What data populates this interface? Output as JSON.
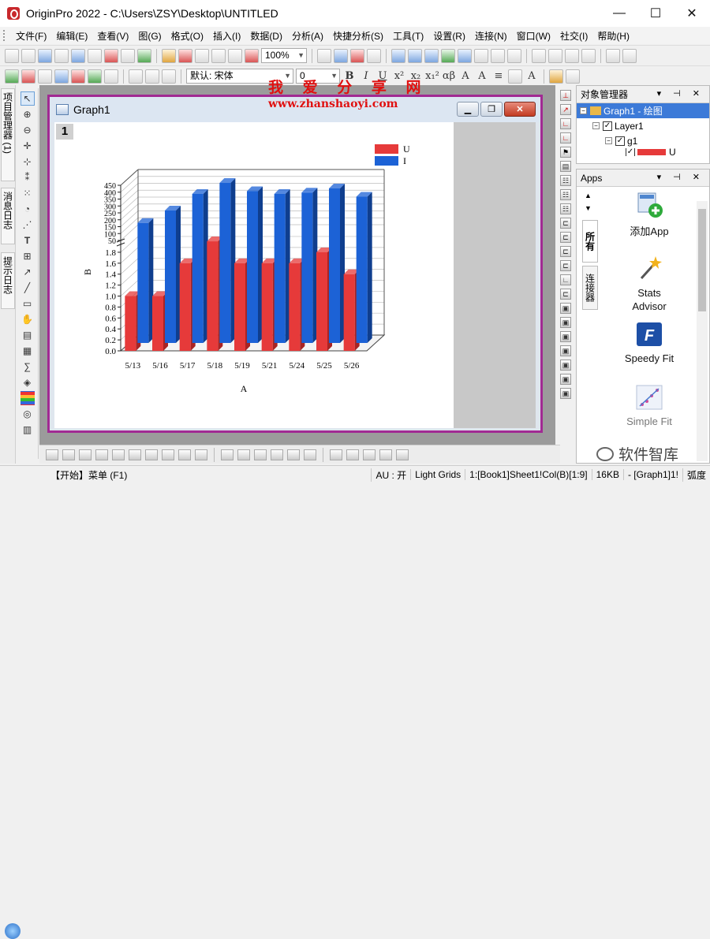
{
  "window": {
    "title": "OriginPro 2022 - C:\\Users\\ZSY\\Desktop\\UNTITLED",
    "controls": [
      "—",
      "☐",
      "✕"
    ]
  },
  "menu": [
    "文件(F)",
    "编辑(E)",
    "查看(V)",
    "图(G)",
    "格式(O)",
    "插入(I)",
    "数据(D)",
    "分析(A)",
    "快捷分析(S)",
    "工具(T)",
    "设置(R)",
    "连接(N)",
    "窗口(W)",
    "社交(I)",
    "帮助(H)"
  ],
  "toolbar": {
    "zoom": "100%",
    "font_name": "默认: 宋体",
    "font_size": "0"
  },
  "left_tabs": [
    "项目管理器 (1)",
    "消息日志",
    "提示日志"
  ],
  "watermark": {
    "cn": "我 爱 分 享 网",
    "url": "www.zhanshaoyi.com"
  },
  "graph_window": {
    "title": "Graph1",
    "layer_badge": "1"
  },
  "object_manager": {
    "title": "对象管理器",
    "tree": [
      {
        "label": "Graph1 - 绘图",
        "selected": true
      },
      {
        "label": "Layer1",
        "selected": false
      },
      {
        "label": "g1",
        "selected": false
      },
      {
        "label": "U",
        "selected": false
      }
    ]
  },
  "apps": {
    "title": "Apps",
    "tabs": [
      "所有",
      "连接器"
    ],
    "items": [
      "添加App",
      "Stats Advisor",
      "Speedy Fit",
      "Simple Fit"
    ]
  },
  "status": {
    "left": "【开始】菜单 (F1)",
    "segments": [
      "AU : 开",
      "Light Grids",
      "1:[Book1]Sheet1!Col(B)[1:9]",
      "16KB",
      "- [Graph1]1!",
      "弧度"
    ]
  },
  "brand_watermark": "软件智库",
  "chart_data": {
    "type": "bar",
    "subtype": "3d-grouped-bar-broken-y",
    "categories": [
      "5/13",
      "5/16",
      "5/17",
      "5/18",
      "5/19",
      "5/21",
      "5/24",
      "5/25",
      "5/26"
    ],
    "series": [
      {
        "name": "U",
        "color": "#e63a3a",
        "values": [
          1.0,
          1.0,
          1.6,
          2.0,
          1.6,
          1.6,
          1.6,
          1.8,
          1.4
        ]
      },
      {
        "name": "I",
        "color": "#1c62d6",
        "values": [
          120,
          210,
          330,
          410,
          350,
          330,
          340,
          370,
          310
        ]
      }
    ],
    "xlabel": "A",
    "ylabel": "B",
    "y_lower": {
      "range": [
        0,
        1.9
      ],
      "ticks": [
        "0.0",
        "0.2",
        "0.4",
        "0.6",
        "0.8",
        "1.0",
        "1.2",
        "1.4",
        "1.6",
        "1.8"
      ]
    },
    "y_upper": {
      "range": [
        50,
        450
      ],
      "ticks": [
        "50",
        "100",
        "150",
        "200",
        "250",
        "300",
        "350",
        "400",
        "450"
      ]
    },
    "legend": "top-right",
    "grid": true
  }
}
